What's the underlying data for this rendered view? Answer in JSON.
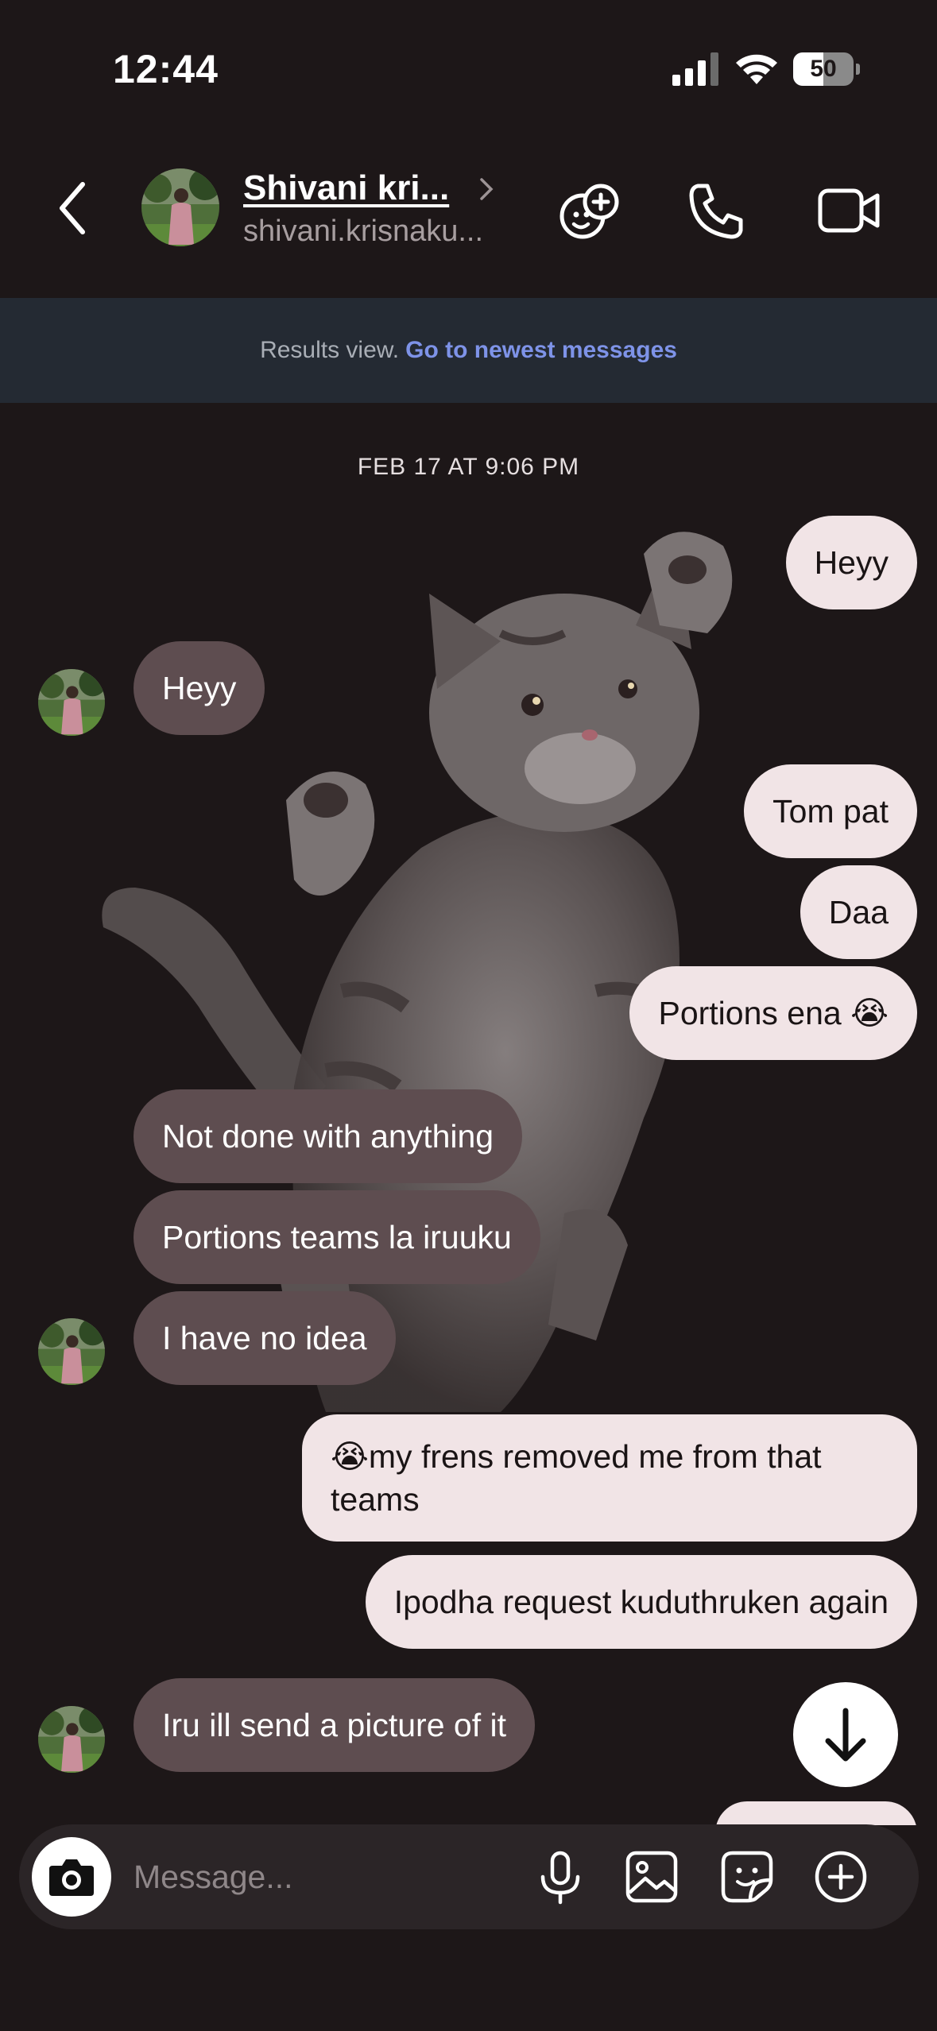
{
  "status_bar": {
    "time": "12:44",
    "battery_percent": "50",
    "battery_level": 0.5
  },
  "header": {
    "contact_name": "Shivani kri...",
    "contact_handle": "shivani.krisnaku...",
    "icons": [
      "back-chevron-icon",
      "effects-icon",
      "phone-icon",
      "video-icon"
    ]
  },
  "banner": {
    "label": "Results view.",
    "link": "Go to newest messages"
  },
  "chat": {
    "timestamp": "FEB 17 AT 9:06 PM",
    "messages": [
      {
        "dir": "out",
        "text": "Heyy"
      },
      {
        "dir": "in",
        "text": "Heyy"
      },
      {
        "dir": "out",
        "text": "Tom pat"
      },
      {
        "dir": "out",
        "text": "Daa"
      },
      {
        "dir": "out",
        "text": "Portions ena 😭"
      },
      {
        "dir": "in",
        "text": "Not done with anything"
      },
      {
        "dir": "in",
        "text": "Portions teams la iruuku"
      },
      {
        "dir": "in",
        "text": "I have no idea"
      },
      {
        "dir": "out",
        "text": "😭my frens removed me from that teams"
      },
      {
        "dir": "out",
        "text": "Ipodha request kuduthruken again"
      },
      {
        "dir": "in",
        "text": "Iru ill send a picture of it"
      }
    ]
  },
  "composer": {
    "placeholder": "Message...",
    "icons": [
      "camera-icon",
      "microphone-icon",
      "gallery-icon",
      "sticker-icon",
      "plus-icon"
    ]
  },
  "colors": {
    "background": "#1d1718",
    "outgoing_bubble": "#f1e4e6",
    "incoming_bubble": "#5e4d50",
    "banner_bg": "#242a33",
    "link": "#7e93e8"
  }
}
